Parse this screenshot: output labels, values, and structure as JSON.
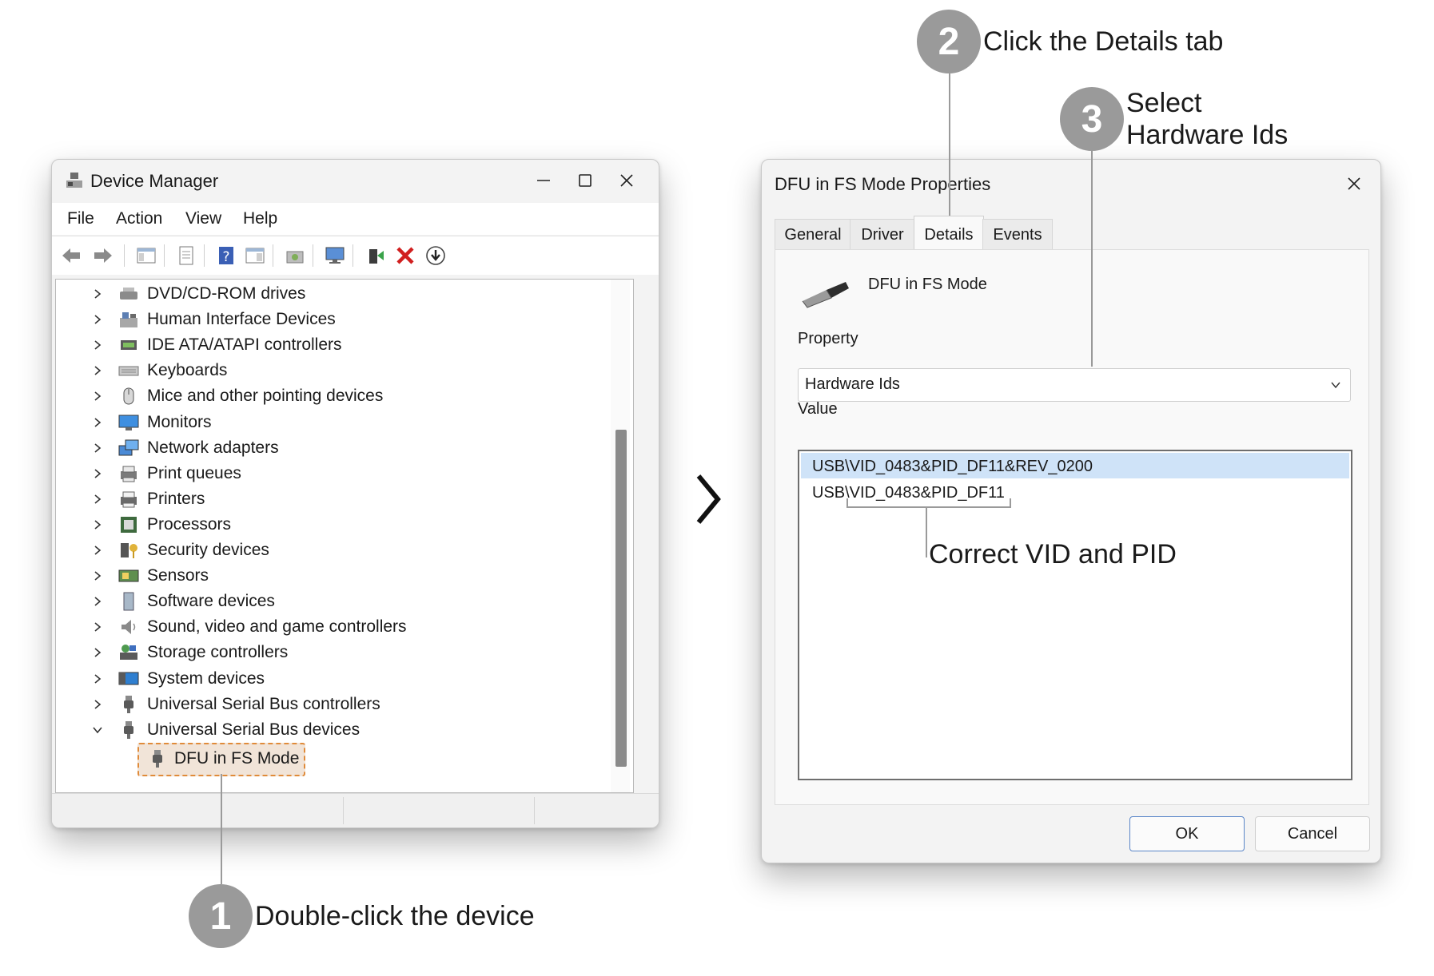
{
  "device_manager": {
    "title": "Device Manager",
    "menu": [
      "File",
      "Action",
      "View",
      "Help"
    ],
    "tree_items": [
      {
        "label": "DVD/CD-ROM drives",
        "icon": "dvd-drive-icon"
      },
      {
        "label": "Human Interface Devices",
        "icon": "hid-icon"
      },
      {
        "label": "IDE ATA/ATAPI controllers",
        "icon": "ide-controller-icon"
      },
      {
        "label": "Keyboards",
        "icon": "keyboard-icon"
      },
      {
        "label": "Mice and other pointing devices",
        "icon": "mouse-icon"
      },
      {
        "label": "Monitors",
        "icon": "monitor-icon"
      },
      {
        "label": "Network adapters",
        "icon": "network-adapter-icon"
      },
      {
        "label": "Print queues",
        "icon": "print-queue-icon"
      },
      {
        "label": "Printers",
        "icon": "printer-icon"
      },
      {
        "label": "Processors",
        "icon": "processor-icon"
      },
      {
        "label": "Security devices",
        "icon": "security-device-icon"
      },
      {
        "label": "Sensors",
        "icon": "sensor-icon"
      },
      {
        "label": "Software devices",
        "icon": "software-device-icon"
      },
      {
        "label": "Sound, video and game controllers",
        "icon": "speaker-icon"
      },
      {
        "label": "Storage controllers",
        "icon": "storage-controller-icon"
      },
      {
        "label": "System devices",
        "icon": "system-device-icon"
      },
      {
        "label": "Universal Serial Bus controllers",
        "icon": "usb-plug-icon"
      },
      {
        "label": "Universal Serial Bus devices",
        "icon": "usb-plug-icon",
        "expanded": true
      }
    ],
    "selected_child": "DFU in FS Mode"
  },
  "properties": {
    "title": "DFU in FS Mode Properties",
    "tabs": [
      "General",
      "Driver",
      "Details",
      "Events"
    ],
    "active_tab": "Details",
    "device_name": "DFU in FS Mode",
    "property_label": "Property",
    "property_value": "Hardware Ids",
    "value_label": "Value",
    "values": [
      "USB\\VID_0483&PID_DF11&REV_0200",
      "USB\\VID_0483&PID_DF11"
    ],
    "ok_label": "OK",
    "cancel_label": "Cancel"
  },
  "annotations": {
    "step1_number": "1",
    "step1_text": "Double-click the device",
    "step2_number": "2",
    "step2_text": "Click the Details tab",
    "step3_number": "3",
    "step3_text_line1": "Select",
    "step3_text_line2": "Hardware Ids",
    "vid_pid_note": "Correct VID and PID"
  },
  "colors": {
    "highlight_border": "#e08b3a",
    "selection": "#cfe3f8",
    "badge": "#9a9a9a"
  }
}
